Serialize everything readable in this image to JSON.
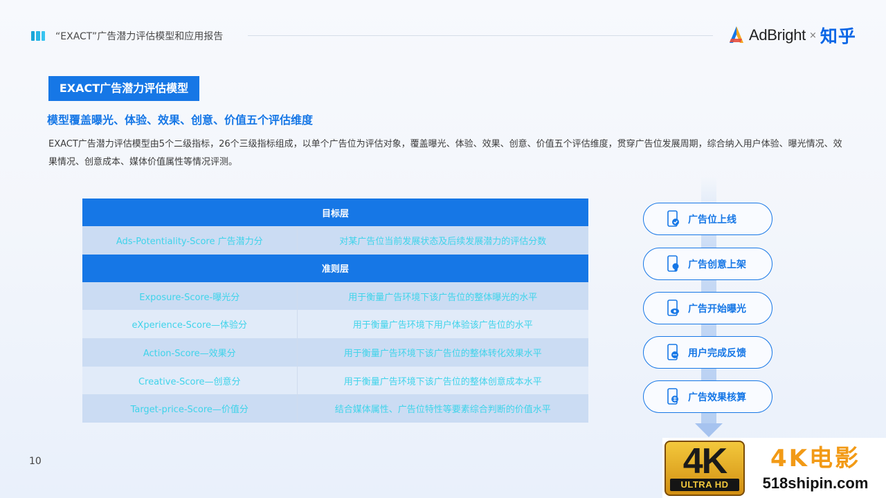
{
  "header": {
    "title": "“EXACT”广告潜力评估模型和应用报告",
    "brand_name": "AdBright",
    "brand_separator": "×",
    "partner_name": "知乎"
  },
  "section": {
    "tag": "EXACT广告潜力评估模型",
    "subtitle": "模型覆盖曝光、体验、效果、创意、价值五个评估维度",
    "description": "EXACT广告潜力评估模型由5个二级指标，26个三级指标组成，以单个广告位为评估对象，覆盖曝光、体验、效果、创意、价值五个评估维度，贯穿广告位发展周期，综合纳入用户体验、曝光情况、效果情况、创意成本、媒体价值属性等情况评测。"
  },
  "table": {
    "target_header": "目标层",
    "target_row": {
      "name": "Ads-Potentiality-Score 广告潜力分",
      "desc": "对某广告位当前发展状态及后续发展潜力的评估分数"
    },
    "criteria_header": "准则层",
    "criteria_rows": [
      {
        "name": "Exposure-Score-曝光分",
        "desc": "用于衡量广告环境下该广告位的整体曝光的水平"
      },
      {
        "name": "eXperience-Score—体验分",
        "desc": "用于衡量广告环境下用户体验该广告位的水平"
      },
      {
        "name": "Action-Score—效果分",
        "desc": "用于衡量广告环境下该广告位的整体转化效果水平"
      },
      {
        "name": "Creative-Score—创意分",
        "desc": "用于衡量广告环境下该广告位的整体创意成本水平"
      },
      {
        "name": "Target-price-Score—价值分",
        "desc": "结合媒体属性、广告位特性等要素综合判断的价值水平"
      }
    ]
  },
  "flow": {
    "steps": [
      {
        "label": "广告位上线",
        "icon": "phone-check-icon"
      },
      {
        "label": "广告创意上架",
        "icon": "phone-bulb-icon"
      },
      {
        "label": "广告开始曝光",
        "icon": "phone-eye-icon"
      },
      {
        "label": "用户完成反馈",
        "icon": "phone-chat-icon"
      },
      {
        "label": "广告效果核算",
        "icon": "phone-calc-icon"
      }
    ]
  },
  "page_number": "10",
  "watermark": {
    "badge_main": "4K",
    "badge_sub": "ULTRA HD",
    "title": "4K电影",
    "url": "518shipin.com"
  },
  "colors": {
    "primary_blue": "#1677e6",
    "cyan_text": "#3fd3ea",
    "watermark_orange": "#f29a16"
  }
}
